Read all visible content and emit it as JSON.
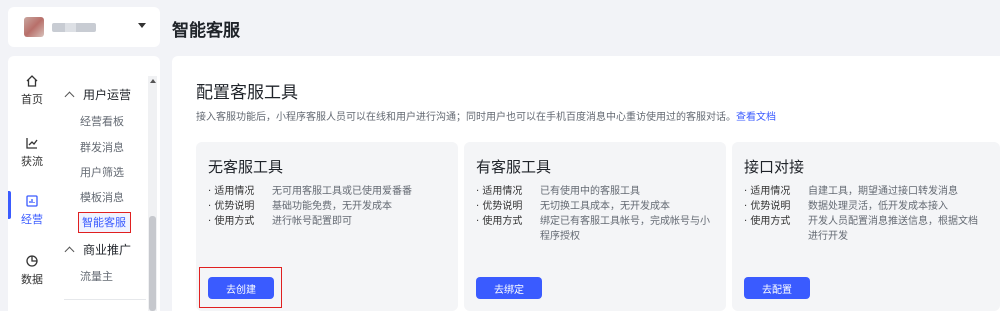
{
  "header": {
    "title": "智能客服",
    "account": {
      "name_masked": "",
      "dropdown_icon": "caret-down-icon"
    }
  },
  "rail": {
    "items": [
      {
        "label": "首页",
        "icon": "home-icon"
      },
      {
        "label": "获流",
        "icon": "chart-line-icon"
      },
      {
        "label": "经营",
        "icon": "dashboard-icon",
        "active": true
      },
      {
        "label": "数据",
        "icon": "pie-chart-icon"
      }
    ]
  },
  "menu": {
    "groups": [
      {
        "label": "用户运营",
        "items": [
          "经营看板",
          "群发消息",
          "用户筛选",
          "模板消息",
          "智能客服"
        ]
      },
      {
        "label": "商业推广",
        "items": [
          "流量主"
        ]
      }
    ],
    "active_item": "智能客服"
  },
  "main": {
    "title": "配置客服工具",
    "description": "接入客服功能后，小程序客服人员可以在线和用户进行沟通；同时用户也可以在手机百度消息中心重访使用过的客服对话。",
    "doc_link": "查看文档",
    "cards": [
      {
        "title": "无客服工具",
        "rows": [
          {
            "k": "· 适用情况",
            "v": "无可用客服工具或已使用爱番番"
          },
          {
            "k": "· 优势说明",
            "v": "基础功能免费，无开发成本"
          },
          {
            "k": "· 使用方式",
            "v": "进行帐号配置即可"
          }
        ],
        "button": "去创建"
      },
      {
        "title": "有客服工具",
        "rows": [
          {
            "k": "· 适用情况",
            "v": "已有使用中的客服工具"
          },
          {
            "k": "· 优势说明",
            "v": "无切换工具成本，无开发成本"
          },
          {
            "k": "· 使用方式",
            "v": "绑定已有客服工具帐号，完成帐号与小程序授权"
          }
        ],
        "button": "去绑定"
      },
      {
        "title": "接口对接",
        "rows": [
          {
            "k": "· 适用情况",
            "v": "自建工具，期望通过接口转发消息"
          },
          {
            "k": "· 优势说明",
            "v": "数据处理灵活，低开发成本接入"
          },
          {
            "k": "· 使用方式",
            "v": "开发人员配置消息推送信息，根据文档进行开发"
          }
        ],
        "button": "去配置"
      }
    ]
  },
  "colors": {
    "accent": "#3a5bff",
    "highlight_border": "#e02020",
    "background": "#f2f3f7"
  }
}
